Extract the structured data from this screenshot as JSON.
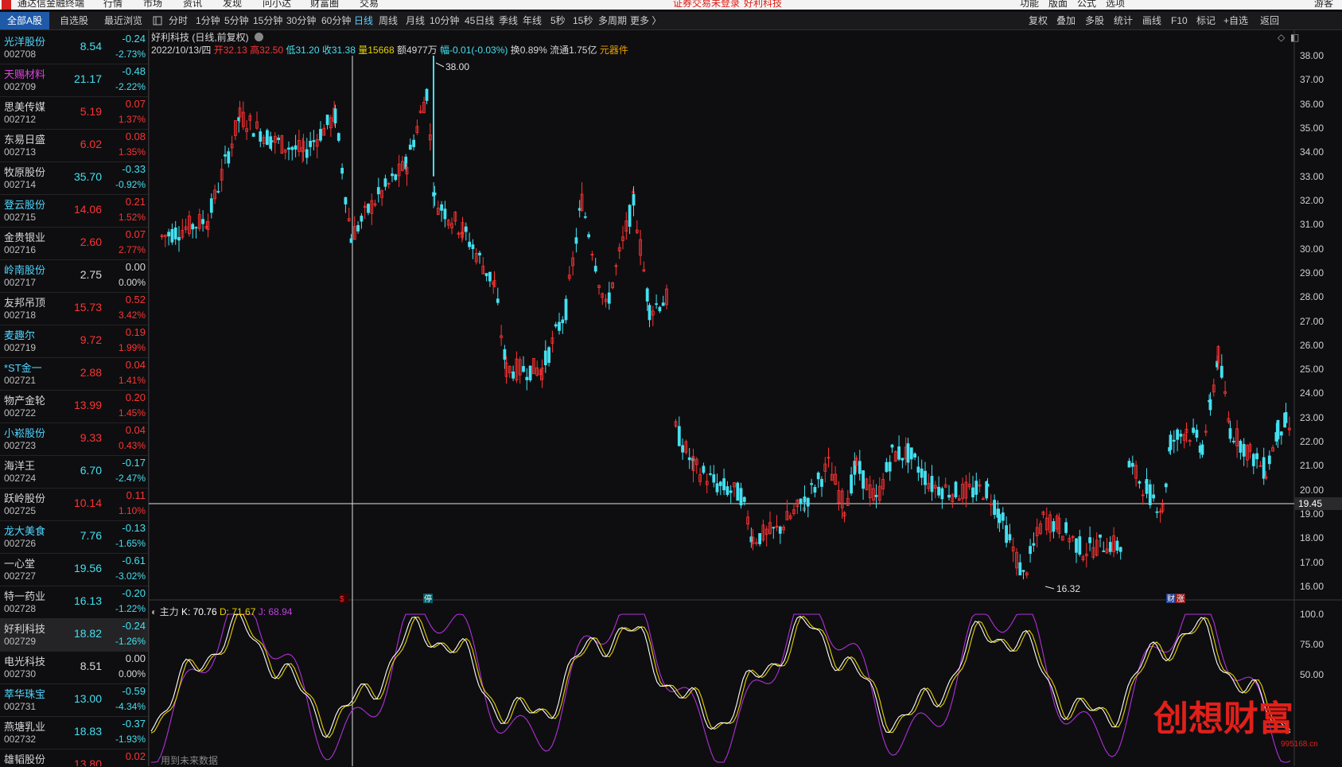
{
  "colors": {
    "up": "#ff3333",
    "down": "#44e0f0",
    "flat": "#d8d8d8",
    "accent": "#5fd1ff",
    "kline": "#ffffff",
    "dline": "#e8d000",
    "jline": "#b030d8",
    "warning": "#e0201a"
  },
  "app": {
    "title": "通达信金融终端",
    "menu": [
      "行情",
      "市场",
      "资讯",
      "发现",
      "问小达",
      "财富圈",
      "交易"
    ],
    "login_warning": "证券交易未登录",
    "current_stock": "好利科技",
    "right_menu": [
      "功能",
      "版面",
      "公式",
      "选项"
    ],
    "user": "游客"
  },
  "left_tabs": [
    "全部A股",
    "自选股",
    "最近浏览"
  ],
  "periods": [
    "分时",
    "1分钟",
    "5分钟",
    "15分钟",
    "30分钟",
    "60分钟",
    "日线",
    "周线",
    "月线",
    "10分钟",
    "45日线",
    "季线",
    "年线",
    "5秒",
    "15秒",
    "多周期",
    "更多 〉"
  ],
  "active_period": "日线",
  "right_tools": [
    "复权",
    "叠加",
    "多股",
    "统计",
    "画线",
    "F10",
    "标记",
    "+自选",
    "返回"
  ],
  "watchlist": [
    {
      "name": "光洋股份",
      "code": "002708",
      "price": "8.54",
      "change": "-0.24",
      "pct": "-2.73%",
      "dir": "down",
      "name_color": "#4fd6ff"
    },
    {
      "name": "天赐材料",
      "code": "002709",
      "price": "21.17",
      "change": "-0.48",
      "pct": "-2.22%",
      "dir": "down",
      "name_color": "#e040e0"
    },
    {
      "name": "思美传媒",
      "code": "002712",
      "price": "5.19",
      "change": "0.07",
      "pct": "1.37%",
      "dir": "up",
      "name_color": "#d8d8d8"
    },
    {
      "name": "东易日盛",
      "code": "002713",
      "price": "6.02",
      "change": "0.08",
      "pct": "1.35%",
      "dir": "up",
      "name_color": "#d8d8d8"
    },
    {
      "name": "牧原股份",
      "code": "002714",
      "price": "35.70",
      "change": "-0.33",
      "pct": "-0.92%",
      "dir": "down",
      "name_color": "#d8d8d8"
    },
    {
      "name": "登云股份",
      "code": "002715",
      "price": "14.06",
      "change": "0.21",
      "pct": "1.52%",
      "dir": "up",
      "name_color": "#4fd6ff"
    },
    {
      "name": "金贵银业",
      "code": "002716",
      "price": "2.60",
      "change": "0.07",
      "pct": "2.77%",
      "dir": "up",
      "name_color": "#d8d8d8"
    },
    {
      "name": "岭南股份",
      "code": "002717",
      "price": "2.75",
      "change": "0.00",
      "pct": "0.00%",
      "dir": "flat",
      "name_color": "#4fd6ff"
    },
    {
      "name": "友邦吊顶",
      "code": "002718",
      "price": "15.73",
      "change": "0.52",
      "pct": "3.42%",
      "dir": "up",
      "name_color": "#d8d8d8"
    },
    {
      "name": "麦趣尔",
      "code": "002719",
      "price": "9.72",
      "change": "0.19",
      "pct": "1.99%",
      "dir": "up",
      "name_color": "#4fd6ff"
    },
    {
      "name": "*ST金一",
      "code": "002721",
      "price": "2.88",
      "change": "0.04",
      "pct": "1.41%",
      "dir": "up",
      "name_color": "#4fd6ff"
    },
    {
      "name": "物产金轮",
      "code": "002722",
      "price": "13.99",
      "change": "0.20",
      "pct": "1.45%",
      "dir": "up",
      "name_color": "#d8d8d8"
    },
    {
      "name": "小崧股份",
      "code": "002723",
      "price": "9.33",
      "change": "0.04",
      "pct": "0.43%",
      "dir": "up",
      "name_color": "#4fd6ff"
    },
    {
      "name": "海洋王",
      "code": "002724",
      "price": "6.70",
      "change": "-0.17",
      "pct": "-2.47%",
      "dir": "down",
      "name_color": "#d8d8d8"
    },
    {
      "name": "跃岭股份",
      "code": "002725",
      "price": "10.14",
      "change": "0.11",
      "pct": "1.10%",
      "dir": "up",
      "name_color": "#d8d8d8"
    },
    {
      "name": "龙大美食",
      "code": "002726",
      "price": "7.76",
      "change": "-0.13",
      "pct": "-1.65%",
      "dir": "down",
      "name_color": "#4fd6ff"
    },
    {
      "name": "一心堂",
      "code": "002727",
      "price": "19.56",
      "change": "-0.61",
      "pct": "-3.02%",
      "dir": "down",
      "name_color": "#d8d8d8"
    },
    {
      "name": "特一药业",
      "code": "002728",
      "price": "16.13",
      "change": "-0.20",
      "pct": "-1.22%",
      "dir": "down",
      "name_color": "#d8d8d8"
    },
    {
      "name": "好利科技",
      "code": "002729",
      "price": "18.82",
      "change": "-0.24",
      "pct": "-1.26%",
      "dir": "down",
      "name_color": "#d8d8d8"
    },
    {
      "name": "电光科技",
      "code": "002730",
      "price": "8.51",
      "change": "0.00",
      "pct": "0.00%",
      "dir": "flat",
      "name_color": "#d8d8d8"
    },
    {
      "name": "萃华珠宝",
      "code": "002731",
      "price": "13.00",
      "change": "-0.59",
      "pct": "-4.34%",
      "dir": "down",
      "name_color": "#4fd6ff"
    },
    {
      "name": "燕塘乳业",
      "code": "002732",
      "price": "18.83",
      "change": "-0.37",
      "pct": "-1.93%",
      "dir": "down",
      "name_color": "#d8d8d8"
    },
    {
      "name": "雄韬股份",
      "code": "",
      "price": "13.80",
      "change": "0.02",
      "pct": "",
      "dir": "up",
      "name_color": "#d8d8d8"
    }
  ],
  "selected_index": 18,
  "chart": {
    "title": "好利科技 (日线,前复权)",
    "date": "2022/10/13/四",
    "open_label": "开32.13",
    "high_label": "高32.50",
    "low_label": "低31.20",
    "close_label": "收31.38",
    "vol_label": "量15668",
    "amount_label": "额4977万",
    "range_label": "幅-0.01(-0.03%)",
    "turnover_label": "换0.89%",
    "float_label": "流通1.75亿",
    "sector_label": "元器件",
    "price_axis": [
      "38.00",
      "37.00",
      "36.00",
      "35.00",
      "34.00",
      "33.00",
      "32.00",
      "31.00",
      "30.00",
      "29.00",
      "28.00",
      "27.00",
      "26.00",
      "25.00",
      "24.00",
      "23.00",
      "22.00",
      "21.00",
      "20.00",
      "19.00",
      "18.00",
      "17.00",
      "16.00"
    ],
    "crosshair_price": "19.45",
    "max_label": "38.00",
    "min_label": "16.32",
    "markers": {
      "s": "$",
      "ting": "停",
      "cai": "财",
      "zhang": "涨"
    }
  },
  "kdj": {
    "name": "主力",
    "k_label": "K: 70.76",
    "d_label": "D: 71.67",
    "j_label": "J: 68.94",
    "axis": [
      "100.0",
      "75.00",
      "50.00"
    ],
    "future_note": "用到未来数据"
  },
  "watermark": {
    "text": "创想财富",
    "url": "995168.cn"
  }
}
